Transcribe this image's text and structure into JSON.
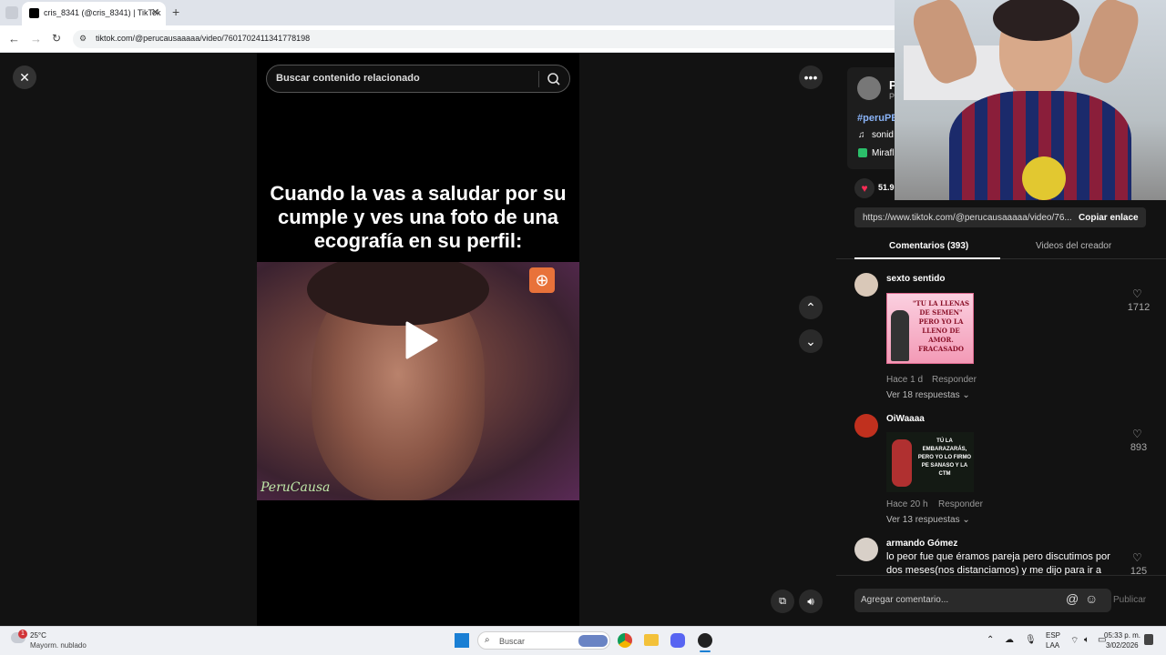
{
  "browser": {
    "tab_title": "cris_8341 (@cris_8341) | TikTok",
    "url": "tiktok.com/@perucausaaaaa/video/7601702411341778198"
  },
  "video": {
    "search_placeholder": "Buscar contenido relacionado",
    "caption": "Cuando la vas a saludar por su cumple y ves una foto de una ecografía en su perfil:",
    "watermark": "PeruCausa"
  },
  "panel": {
    "author_initial": "P",
    "author_sub": "P",
    "hashtag": "#peruPE",
    "sound_label": "sonid",
    "location_label": "Mirafl",
    "likes": "51.9",
    "link_url": "https://www.tiktok.com/@perucausaaaaa/video/76...",
    "copy_link": "Copiar enlace",
    "tab_comments": "Comentarios (393)",
    "tab_creator": "Videos del creador",
    "comments": [
      {
        "name": "sexto sentido",
        "meta_time": "Hace 1 d",
        "reply": "Responder",
        "replies": "Ver 18 respuestas",
        "likes": "1712",
        "meme_text": "\"TU LA LLENAS DE SEMEN\" PERO YO LA LLENO DE AMOR. FRACASADO"
      },
      {
        "name": "OiWaaaa",
        "meta_time": "Hace 20 h",
        "reply": "Responder",
        "replies": "Ver 13 respuestas",
        "likes": "893",
        "meme_text": "TÚ LA EMBARAZARÁS, PERO YO LO FIRMO PE SANASO Y LA CTM"
      },
      {
        "name": "armando Gómez",
        "text": "lo peor fue que éramos pareja pero discutimos por dos meses(nos distanciamos) y me dijo para ir a",
        "likes": "125"
      }
    ],
    "comment_placeholder": "Agregar comentario...",
    "publish": "Publicar"
  },
  "taskbar": {
    "temp": "25°C",
    "weather": "Mayorm. nublado",
    "weather_badge": "1",
    "search": "Buscar",
    "lang1": "ESP",
    "lang2": "LAA",
    "time": "05:33 p. m.",
    "date": "3/02/2026"
  },
  "colors": {
    "accent_red": "#fe2c55",
    "bg": "#121212"
  }
}
